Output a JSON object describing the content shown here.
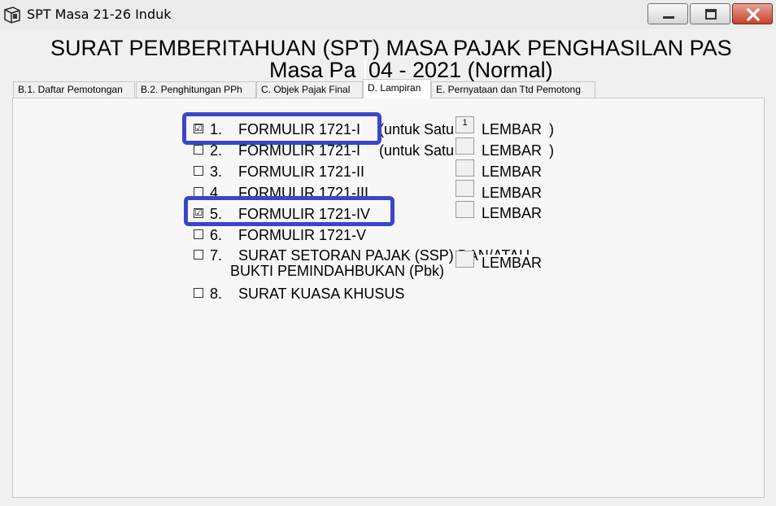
{
  "window": {
    "title": "SPT Masa 21-26 Induk",
    "app_icon": "document-icon",
    "controls": [
      "minimize-icon",
      "maximize-icon",
      "close-icon"
    ]
  },
  "header": {
    "line1": "SURAT PEMBERITAHUAN (SPT) MASA PAJAK PENGHASILAN PAS",
    "line2_prefix": "Masa Pa",
    "line2_period": "04 - 2021 (Normal)"
  },
  "tabs": [
    {
      "label": "B.1. Daftar Pemotongan",
      "active": false
    },
    {
      "label": "B.2. Penghitungan PPh",
      "active": false
    },
    {
      "label": "C. Objek Pajak Final",
      "active": false
    },
    {
      "label": "D. Lampiran",
      "active": true
    },
    {
      "label": "E. Pernyataan dan Ttd Pemotong",
      "active": false
    }
  ],
  "attachments": [
    {
      "num": "1.",
      "label": "FORMULIR 1721-I",
      "suffix": "(untuk Satu",
      "suffix_end": ")",
      "checked": true,
      "lembar_value": "1",
      "lembar_label": "LEMBAR",
      "highlighted": true
    },
    {
      "num": "2.",
      "label": "FORMULIR 1721-I",
      "suffix": "(untuk Satu",
      "suffix_end": ")",
      "checked": false,
      "lembar_value": "",
      "lembar_label": "LEMBAR",
      "highlighted": false
    },
    {
      "num": "3.",
      "label": "FORMULIR 1721-II",
      "checked": false,
      "lembar_value": "",
      "lembar_label": "LEMBAR",
      "highlighted": false
    },
    {
      "num": "4.",
      "label": "FORMULIR 1721-III",
      "checked": false,
      "lembar_value": "",
      "lembar_label": "LEMBAR",
      "highlighted": false
    },
    {
      "num": "5.",
      "label": "FORMULIR 1721-IV",
      "checked": true,
      "lembar_value": "",
      "lembar_label": "LEMBAR",
      "highlighted": true
    },
    {
      "num": "6.",
      "label": "FORMULIR 1721-V",
      "checked": false,
      "highlighted": false
    },
    {
      "num": "7.",
      "label": "SURAT SETORAN PAJAK (SSP) DAN/ATAU",
      "label2": "BUKTI PEMINDAHBUKAN (Pbk)",
      "checked": false,
      "lembar_value": "",
      "lembar_label": "LEMBAR",
      "highlighted": false
    },
    {
      "num": "8.",
      "label": "SURAT KUASA KHUSUS",
      "checked": false,
      "highlighted": false
    }
  ],
  "checkbox_marks": {
    "checked": "☑",
    "unchecked": ""
  },
  "colors": {
    "highlight": "#3c45c8",
    "close_button": "#c4422c"
  }
}
